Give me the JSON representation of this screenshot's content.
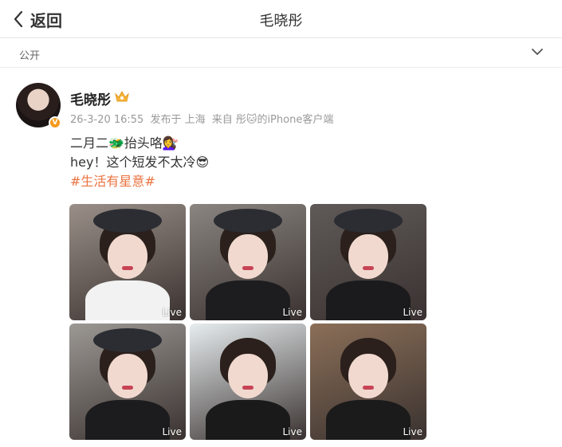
{
  "header": {
    "back_label": "返回",
    "title": "毛晓彤"
  },
  "visibility": {
    "label": "公开"
  },
  "post": {
    "username": "毛晓彤",
    "verified_badge": "V",
    "meta": {
      "date": "26-3-20 16:55",
      "location": "发布于 上海",
      "source": "来自 彤🐱的iPhone客户端"
    },
    "text_lines": [
      "二月二🐲抬头咯💇‍♀️",
      "hey！这个短发不太冷😎"
    ],
    "hashtag": "#生活有星意#",
    "photos": [
      {
        "live_label": "Live",
        "bg": "#9a8f88",
        "body": "#f2f2f2"
      },
      {
        "live_label": "Live",
        "bg": "#8a8580",
        "body": "#1d1d1f"
      },
      {
        "live_label": "Live",
        "bg": "#5f5a58",
        "body": "#1b1b1d"
      },
      {
        "live_label": "Live",
        "bg": "#9c9894",
        "body": "#1c1c1e"
      },
      {
        "live_label": "Live",
        "bg": "#e7edef",
        "body": "#1a1a1a"
      },
      {
        "live_label": "Live",
        "bg": "#8b6f58",
        "body": "#1b1b1b"
      }
    ]
  },
  "colors": {
    "accent": "#eb7340",
    "badge": "#f59a1b"
  }
}
